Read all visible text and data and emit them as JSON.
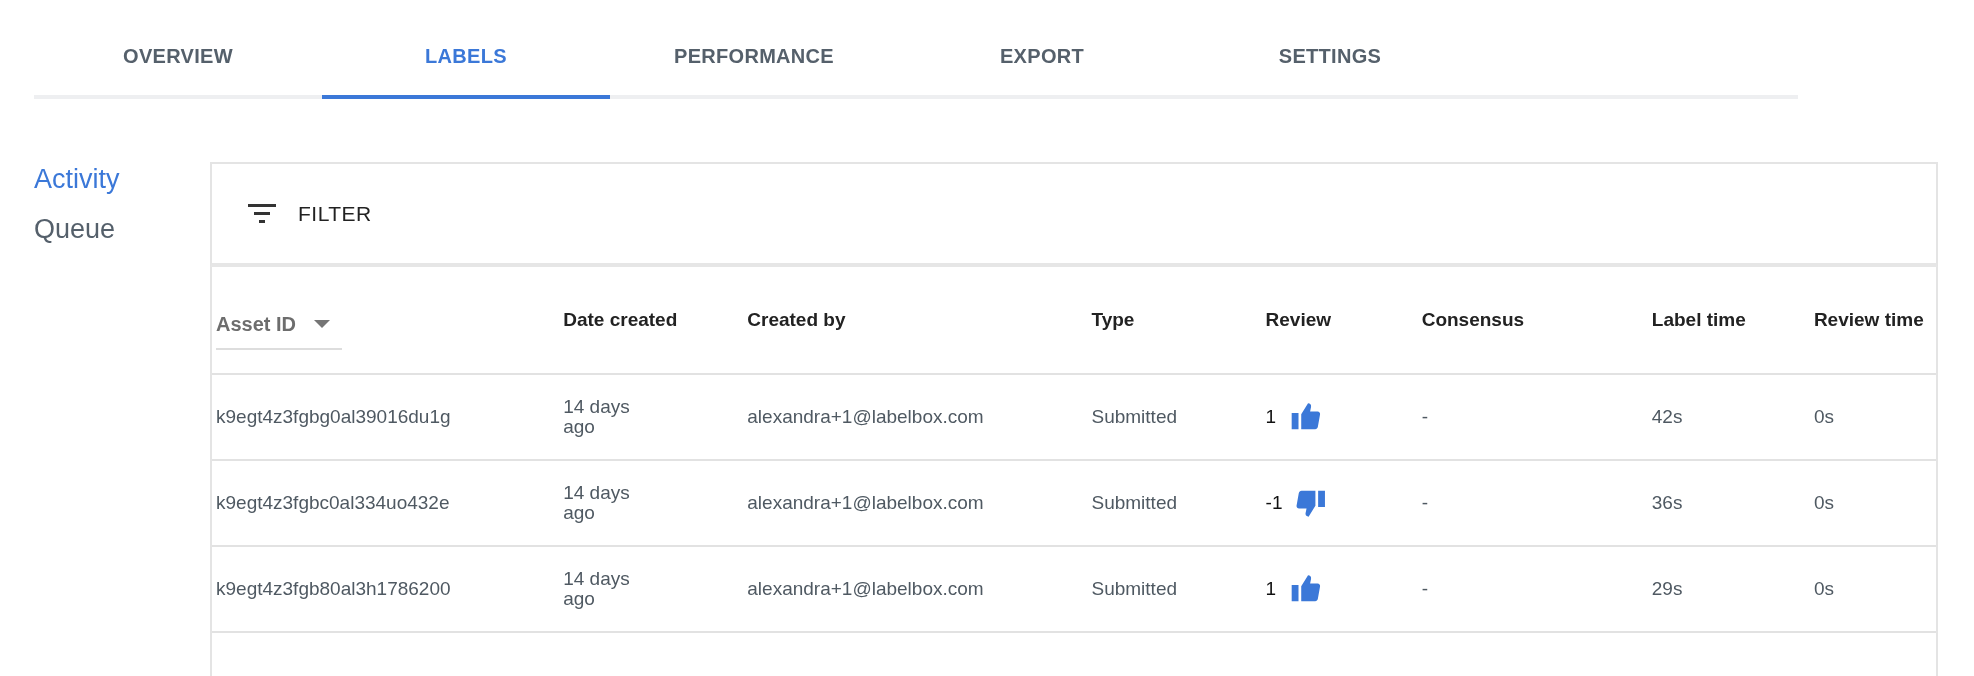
{
  "tabs": [
    {
      "label": "OVERVIEW",
      "selected": false
    },
    {
      "label": "LABELS",
      "selected": true
    },
    {
      "label": "PERFORMANCE",
      "selected": false
    },
    {
      "label": "EXPORT",
      "selected": false
    },
    {
      "label": "SETTINGS",
      "selected": false
    }
  ],
  "sidebar": {
    "items": [
      {
        "label": "Activity",
        "selected": true
      },
      {
        "label": "Queue",
        "selected": false
      }
    ]
  },
  "filter": {
    "label": "FILTER"
  },
  "table": {
    "columns": [
      {
        "label": "Asset ID",
        "dropdown": true
      },
      {
        "label": "Date created",
        "dropdown": false
      },
      {
        "label": "Created by",
        "dropdown": false
      },
      {
        "label": "Type",
        "dropdown": false
      },
      {
        "label": "Review",
        "dropdown": false
      },
      {
        "label": "Consensus",
        "dropdown": false
      },
      {
        "label": "Label time",
        "dropdown": false
      },
      {
        "label": "Review time",
        "dropdown": false
      }
    ],
    "rows": [
      {
        "asset_id": "k9egt4z3fgbg0al39016du1g",
        "date_created": "14 days ago",
        "created_by": "alexandra+1@labelbox.com",
        "type": "Submitted",
        "review": "1",
        "kind": "up",
        "consensus": "-",
        "label_time": "42s",
        "review_time": "0s"
      },
      {
        "asset_id": "k9egt4z3fgbc0al334uo432e",
        "date_created": "14 days ago",
        "created_by": "alexandra+1@labelbox.com",
        "type": "Submitted",
        "review": "-1",
        "kind": "down",
        "consensus": "-",
        "label_time": "36s",
        "review_time": "0s"
      },
      {
        "asset_id": "k9egt4z3fgb80al3h1786200",
        "date_created": "14 days ago",
        "created_by": "alexandra+1@labelbox.com",
        "type": "Submitted",
        "review": "1",
        "kind": "up",
        "consensus": "-",
        "label_time": "29s",
        "review_time": "0s"
      }
    ]
  }
}
